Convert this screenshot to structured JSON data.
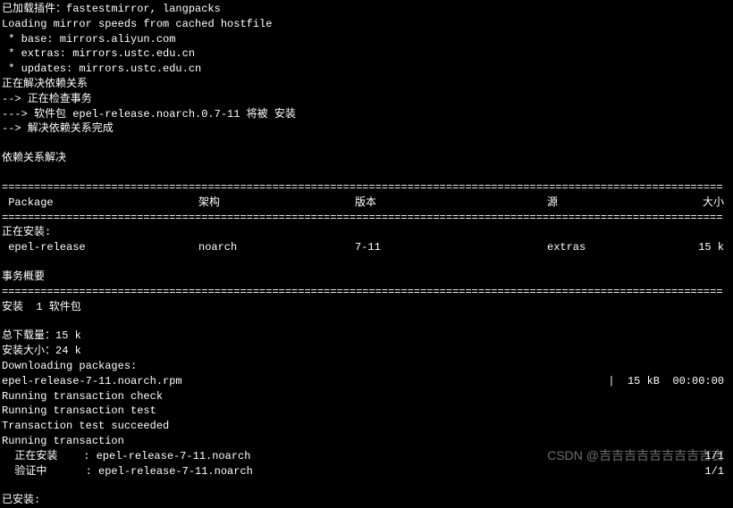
{
  "preamble": {
    "line1": "已加载插件：fastestmirror, langpacks",
    "line2": "Loading mirror speeds from cached hostfile",
    "line3": " * base: mirrors.aliyun.com",
    "line4": " * extras: mirrors.ustc.edu.cn",
    "line5": " * updates: mirrors.ustc.edu.cn",
    "line6": "正在解决依赖关系",
    "line7": "--> 正在检查事务",
    "line8": "---> 软件包 epel-release.noarch.0.7-11 将被 安装",
    "line9": "--> 解决依赖关系完成",
    "line10": "依赖关系解决"
  },
  "divider": "================================================================================================================",
  "table": {
    "header": {
      "package": " Package",
      "arch": "架构",
      "version": "版本",
      "repo": "源",
      "size": "大小"
    },
    "installing_label": "正在安装:",
    "row": {
      "package": " epel-release",
      "arch": "noarch",
      "version": "7-11",
      "repo": "extras",
      "size": "15 k"
    }
  },
  "summary": {
    "label": "事务概要",
    "install_count": "安装  1 软件包",
    "total_download": "总下载量：15 k",
    "install_size": "安装大小：24 k"
  },
  "download": {
    "label": "Downloading packages:",
    "file": "epel-release-7-11.noarch.rpm",
    "progress": "|  15 kB  00:00:00"
  },
  "transaction": {
    "check": "Running transaction check",
    "test": "Running transaction test",
    "succeeded": "Transaction test succeeded",
    "running": "Running transaction",
    "installing": "  正在安装    : epel-release-7-11.noarch",
    "installing_count": "1/1",
    "verifying": "  验证中      : epel-release-7-11.noarch",
    "verifying_count": "1/1"
  },
  "footer": {
    "installed": "已安装:"
  },
  "watermark": "CSDN @吉吉吉吉吉吉吉吉吉吉"
}
